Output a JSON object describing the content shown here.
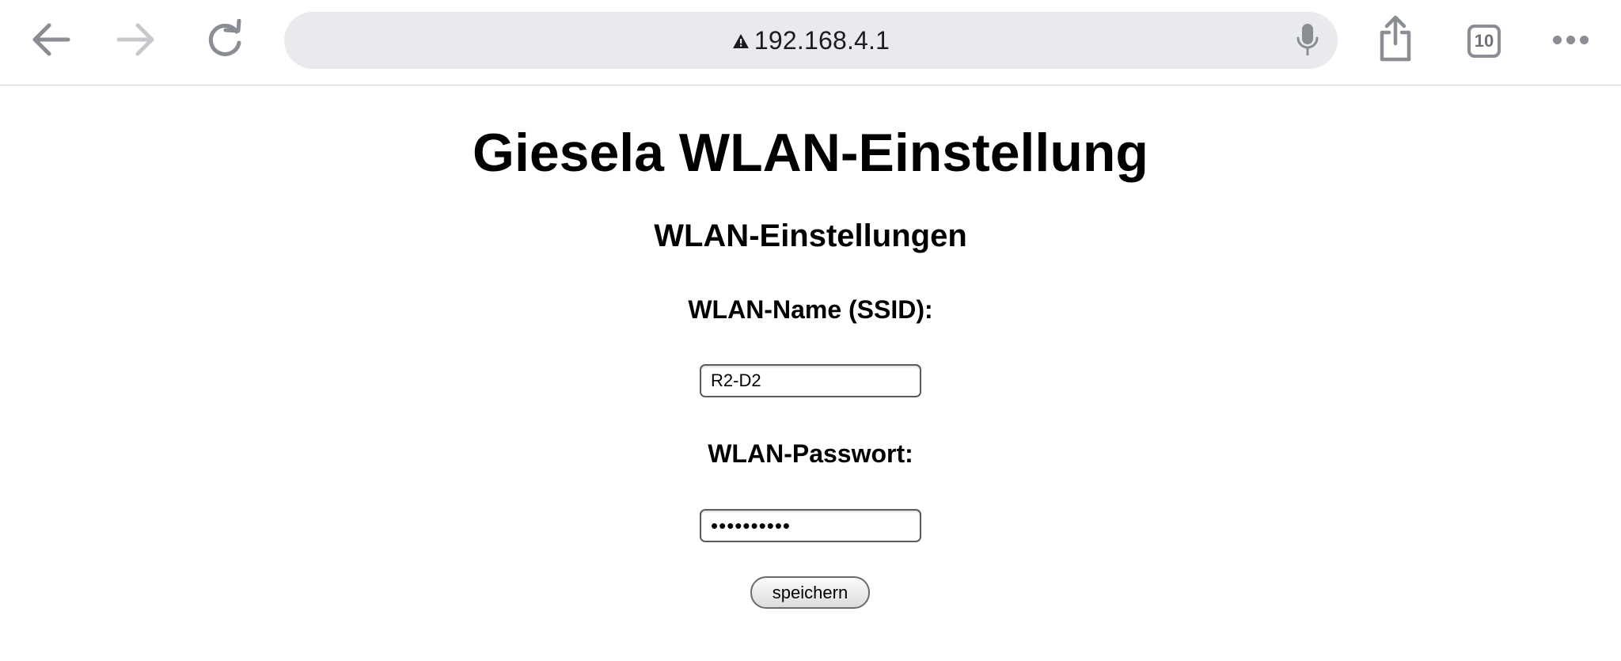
{
  "browser": {
    "url": "192.168.4.1",
    "tab_count": "10",
    "icons": {
      "back": "back-arrow-icon",
      "forward": "forward-arrow-icon",
      "reload": "reload-icon",
      "warning": "warning-triangle-icon",
      "mic": "microphone-icon",
      "share": "share-icon",
      "tabs": "tabs-icon",
      "more": "more-icon"
    }
  },
  "page": {
    "title": "Giesela WLAN-Einstellung",
    "section_title": "WLAN-Einstellungen",
    "ssid_label": "WLAN-Name (SSID):",
    "ssid_value": "R2-D2",
    "password_label": "WLAN-Passwort:",
    "password_value": "••••••••••",
    "save_label": "speichern"
  },
  "colors": {
    "urlbar_bg": "#e9eaee",
    "icon_gray": "#8a8d93",
    "icon_disabled": "#c7c8cc"
  }
}
